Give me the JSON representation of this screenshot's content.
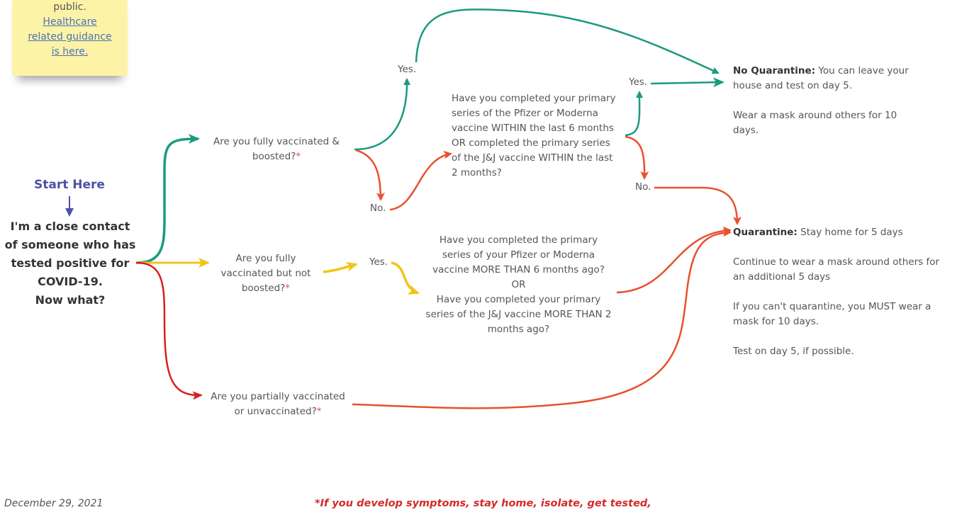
{
  "sticky_note": {
    "text_top": "public.",
    "link_line1": "Healthcare",
    "link_line2": "related guidance",
    "link_line3": "is here."
  },
  "start": {
    "label": "Start Here",
    "line1": "I'm a close contact",
    "line2": "of someone who has",
    "line3": "tested positive for",
    "line4": "COVID-19.",
    "line5": "Now what?"
  },
  "questions": {
    "boosted": {
      "line1": "Are you fully vaccinated &",
      "line2": "boosted?",
      "mark": "*"
    },
    "not_boosted": {
      "line1": "Are you fully",
      "line2": "vaccinated but not",
      "line3": "boosted?",
      "mark": "*"
    },
    "unvaccinated": {
      "line1": "Are you partially vaccinated",
      "line2": "or unvaccinated?",
      "mark": "*"
    },
    "within": {
      "lines": [
        "Have you completed your primary",
        "series of the Pfizer or Moderna",
        "vaccine WITHIN the last 6 months",
        "OR completed the primary series",
        "of the J&J vaccine WITHIN the last",
        "2 months?"
      ]
    },
    "more_than": {
      "lines": [
        "Have you completed the primary",
        "series of your Pfizer or Moderna",
        "vaccine MORE THAN 6 months ago?",
        "OR",
        "Have you completed your primary",
        "series of the J&J vaccine MORE THAN 2",
        "months ago?"
      ]
    }
  },
  "answers": {
    "yes_boosted": "Yes.",
    "no_boosted": "No.",
    "yes_within": "Yes.",
    "no_within": "No.",
    "yes_not_boosted": "Yes."
  },
  "results": {
    "no_quarantine": {
      "title": "No Quarantine:",
      "text1": " You can leave your house and test on day 5.",
      "text2": "Wear a mask around others for 10 days."
    },
    "quarantine": {
      "title": "Quarantine:",
      "text1": " Stay home for 5 days",
      "text2": "Continue to wear a mask around others for an additional 5 days",
      "text3": "If you can't quarantine, you MUST wear a mask for 10 days.",
      "text4": "Test on day 5, if possible."
    }
  },
  "footer": {
    "date": "December 29, 2021",
    "footnote": "*If you develop symptoms, stay home, isolate, get tested,"
  },
  "colors": {
    "green": "#1a9a80",
    "yellow": "#f2c418",
    "red": "#d62020",
    "orange": "#e8502e",
    "start_blue": "#4b52a5",
    "note_yellow": "#fdf3a7"
  }
}
